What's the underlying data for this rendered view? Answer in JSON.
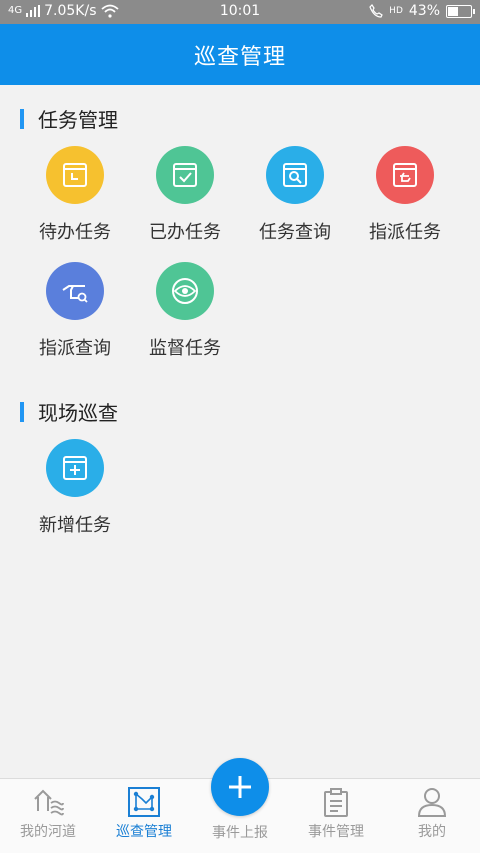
{
  "status": {
    "network": "4G",
    "speed": "7.05K/s",
    "time": "10:01",
    "hd": "HD",
    "battery": "43%"
  },
  "appbar": {
    "title": "巡查管理"
  },
  "sections": {
    "task": {
      "title": "任务管理",
      "items": [
        {
          "label": "待办任务",
          "icon": "calendar-clock-icon",
          "color": "#f6c12f"
        },
        {
          "label": "已办任务",
          "icon": "calendar-check-icon",
          "color": "#4fc595"
        },
        {
          "label": "任务查询",
          "icon": "calendar-search-icon",
          "color": "#2aaee8"
        },
        {
          "label": "指派任务",
          "icon": "assign-hand-icon",
          "color": "#ee5b5b"
        },
        {
          "label": "指派查询",
          "icon": "hand-search-icon",
          "color": "#5a7fdc"
        },
        {
          "label": "监督任务",
          "icon": "eye-icon",
          "color": "#4fc595"
        }
      ]
    },
    "field": {
      "title": "现场巡查",
      "items": [
        {
          "label": "新增任务",
          "icon": "calendar-plus-icon",
          "color": "#2aaee8"
        }
      ]
    }
  },
  "nav": {
    "items": [
      {
        "label": "我的河道",
        "icon": "river-icon"
      },
      {
        "label": "巡查管理",
        "icon": "patrol-icon"
      },
      {
        "label": "事件上报",
        "icon": "plus-icon"
      },
      {
        "label": "事件管理",
        "icon": "clipboard-icon"
      },
      {
        "label": "我的",
        "icon": "user-icon"
      }
    ],
    "active": "巡查管理"
  }
}
